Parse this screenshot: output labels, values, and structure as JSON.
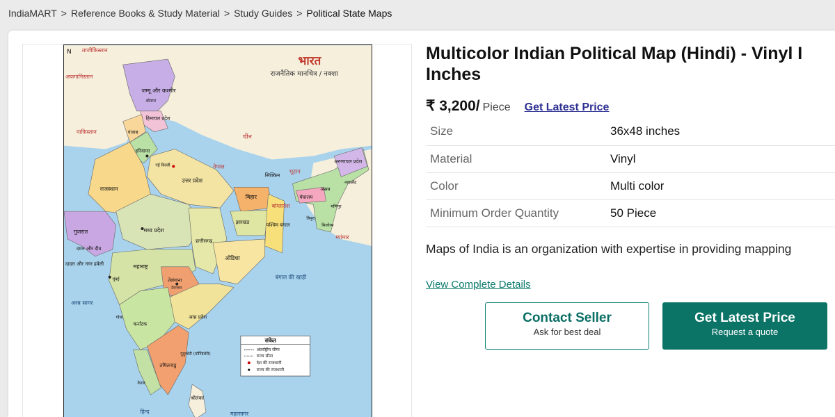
{
  "breadcrumb": {
    "items": [
      "IndiaMART",
      "Reference Books & Study Material",
      "Study Guides",
      "Political State Maps"
    ],
    "separator": ">"
  },
  "product": {
    "title": "Multicolor Indian Political Map (Hindi) - Vinyl I Inches",
    "price": "₹ 3,200/",
    "unit": "Piece",
    "get_latest_price_link": "Get Latest Price",
    "specs": [
      {
        "key": "Size",
        "value": "36x48 inches"
      },
      {
        "key": "Material",
        "value": "Vinyl"
      },
      {
        "key": "Color",
        "value": "Multi color"
      },
      {
        "key": "Minimum Order Quantity",
        "value": "50 Piece"
      }
    ],
    "description": "Maps of India is an organization with expertise in providing mapping",
    "view_details_link": "View Complete Details"
  },
  "buttons": {
    "contact": {
      "label": "Contact Seller",
      "sub": "Ask for best deal"
    },
    "quote": {
      "label": "Get Latest Price",
      "sub": "Request a quote"
    }
  },
  "map": {
    "title": "भारत",
    "subtitle": "राजनैतिक मानचित्र / नक्शा",
    "north": "N",
    "legend_title": "संकेत",
    "legend_items": [
      "अंतर्राष्ट्रीय सीमा",
      "राज्य सीमा",
      "देश की राजधानी",
      "राज्य की राजधानी"
    ],
    "labels": {
      "tajikistan": "ताजीकिस्तान",
      "afghanistan": "अफगानिस्तान",
      "pakistan": "पाकिस्तान",
      "china": "चीन",
      "nepal": "नेपाल",
      "bhutan": "भूटान",
      "bangladesh": "बांग्लादेश",
      "myanmar": "म्यांमार",
      "jk": "जम्मू और कश्मीर",
      "srinagar": "श्रीनगर",
      "hp": "हिमाचल प्रदेश",
      "punjab": "पंजाब",
      "haryana": "हरियाणा",
      "delhi": "नई दिल्ली",
      "up": "उत्तर प्रदेश",
      "rajasthan": "राजस्थान",
      "gujarat": "गुजरात",
      "mp": "मध्य प्रदेश",
      "bihar": "बिहार",
      "jharkhand": "झारखंड",
      "wb": "पश्चिम बंगाल",
      "sikkim": "सिक्किम",
      "assam": "असम",
      "meghalaya": "मेघालय",
      "arunachal": "अरुणाचल प्रदेश",
      "manipur": "मणिपुर",
      "tripura": "त्रिपुरा",
      "mizoram": "मिजोरम",
      "nagaland": "नागालैंड",
      "chhattisgarh": "छत्तीसगढ़",
      "odisha": "ओडिशा",
      "maharashtra": "महाराष्ट्र",
      "mumbai": "मुंबई",
      "daman": "दमन और दीव",
      "dadra": "दादरा और नगर हवेली",
      "telangana": "तेलंगाना",
      "hyderabad": "हैदराबाद",
      "ap": "आंध्र प्रदेश",
      "goa": "गोवा",
      "karnataka": "कर्नाटक",
      "tn": "तमिलनाडु",
      "puducherry": "पुदुच्चेरी (पॉण्डिचेरी)",
      "kerala": "केरल",
      "srilanka": "श्रीलंका",
      "arabian_sea": "अरब सागर",
      "bay_of_bengal": "बंगाल की खाड़ी",
      "indian_ocean": "हिन्द",
      "mahasagar": "महासागर"
    }
  },
  "colors": {
    "accent_teal": "#0b7467",
    "link_blue": "#2e3192",
    "sea": "#a9d3ec"
  }
}
